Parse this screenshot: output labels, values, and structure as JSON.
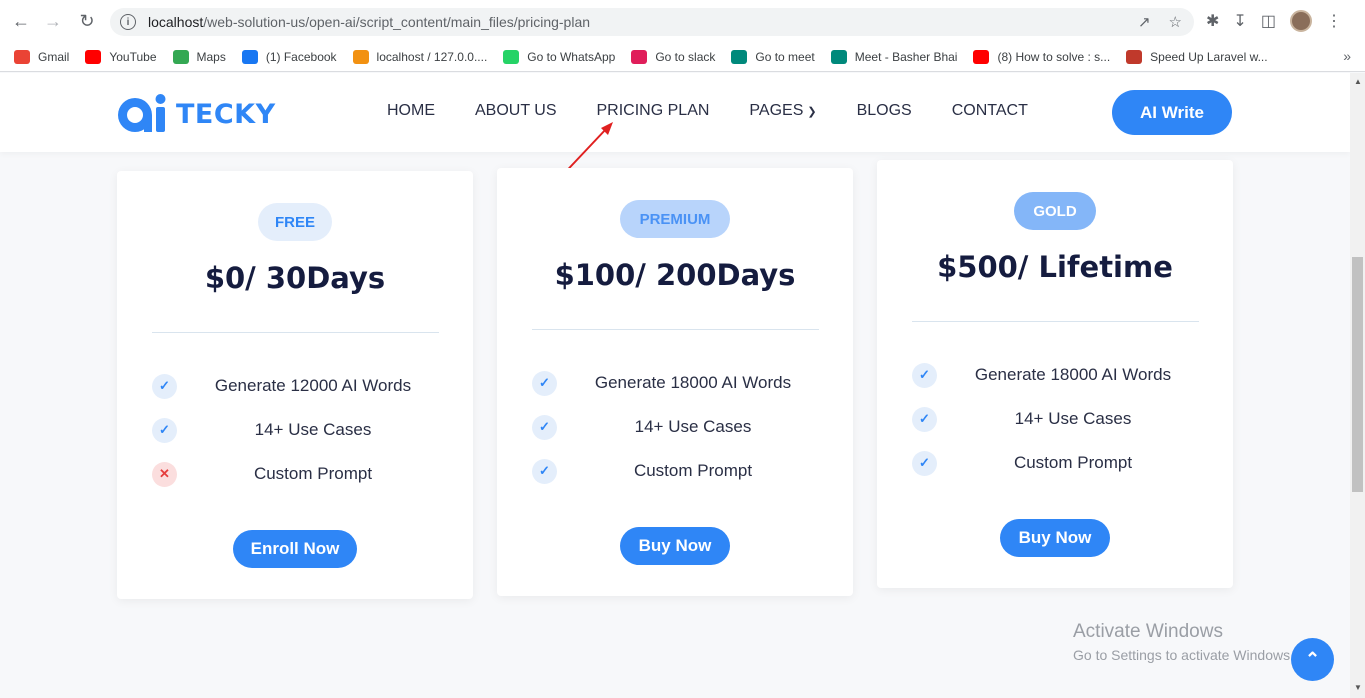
{
  "browser": {
    "url_host": "localhost",
    "url_path": "/web-solution-us/open-ai/script_content/main_files/pricing-plan"
  },
  "bookmarks": [
    {
      "label": "Gmail",
      "icon": "gmail-icon",
      "color": "#ea4335"
    },
    {
      "label": "YouTube",
      "icon": "youtube-icon",
      "color": "#ff0000"
    },
    {
      "label": "Maps",
      "icon": "maps-icon",
      "color": "#34a853"
    },
    {
      "label": "(1) Facebook",
      "icon": "facebook-icon",
      "color": "#1877f2"
    },
    {
      "label": "localhost / 127.0.0....",
      "icon": "phpmyadmin-icon",
      "color": "#f29111"
    },
    {
      "label": "Go to WhatsApp",
      "icon": "whatsapp-icon",
      "color": "#25d366"
    },
    {
      "label": "Go to slack",
      "icon": "slack-icon",
      "color": "#e01e5a"
    },
    {
      "label": "Go to meet",
      "icon": "meet-icon",
      "color": "#00897b"
    },
    {
      "label": "Meet - Basher Bhai",
      "icon": "meet-icon",
      "color": "#00897b"
    },
    {
      "label": "(8) How to solve : s...",
      "icon": "youtube-icon",
      "color": "#ff0000"
    },
    {
      "label": "Speed Up Laravel w...",
      "icon": "laravel-icon",
      "color": "#c0392b"
    }
  ],
  "site": {
    "logo_text": "TECKY",
    "brand_color": "#2f86f6",
    "menu": [
      "HOME",
      "ABOUT US",
      "PRICING PLAN",
      "PAGES",
      "BLOGS",
      "CONTACT"
    ],
    "cta": "AI Write"
  },
  "plans": [
    {
      "badge": "FREE",
      "price": "$0/ 30Days",
      "features": [
        {
          "text": "Generate 12000 AI Words",
          "included": true
        },
        {
          "text": "14+ Use Cases",
          "included": true
        },
        {
          "text": "Custom Prompt",
          "included": false
        }
      ],
      "button": "Enroll Now"
    },
    {
      "badge": "PREMIUM",
      "price": "$100/ 200Days",
      "features": [
        {
          "text": "Generate 18000 AI Words",
          "included": true
        },
        {
          "text": "14+ Use Cases",
          "included": true
        },
        {
          "text": "Custom Prompt",
          "included": true
        }
      ],
      "button": "Buy Now"
    },
    {
      "badge": "GOLD",
      "price": "$500/ Lifetime",
      "features": [
        {
          "text": "Generate 18000 AI Words",
          "included": true
        },
        {
          "text": "14+ Use Cases",
          "included": true
        },
        {
          "text": "Custom Prompt",
          "included": true
        }
      ],
      "button": "Buy Now"
    }
  ],
  "watermark": {
    "line1": "Activate Windows",
    "line2": "Go to Settings to activate Windows."
  }
}
